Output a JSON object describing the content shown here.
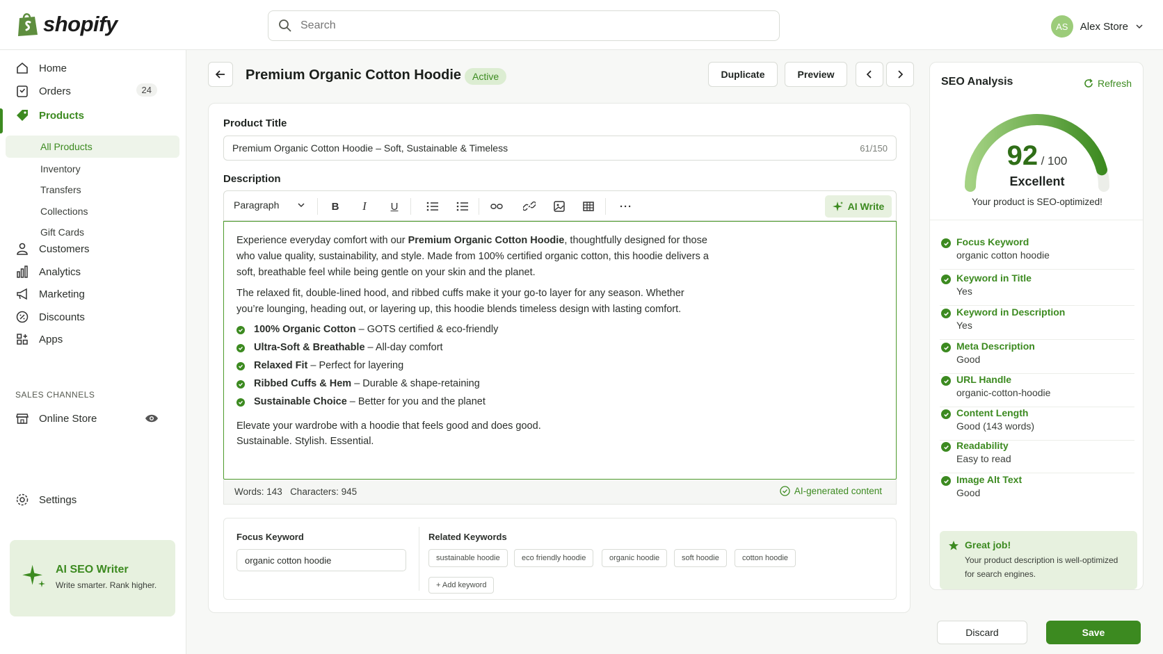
{
  "brand": {
    "name": "shopify",
    "accent": "#3c8a20"
  },
  "search": {
    "placeholder": "Search"
  },
  "user": {
    "initials": "AS",
    "name": "Alex Store"
  },
  "sidebar": {
    "items": [
      {
        "label": "Home",
        "icon": "home-icon"
      },
      {
        "label": "Orders",
        "icon": "orders-icon",
        "badge": "24"
      },
      {
        "label": "Products",
        "icon": "tag-icon"
      },
      {
        "label": "Customers",
        "icon": "person-icon"
      },
      {
        "label": "Analytics",
        "icon": "bar-chart-icon"
      },
      {
        "label": "Marketing",
        "icon": "megaphone-icon"
      },
      {
        "label": "Discounts",
        "icon": "discount-icon"
      },
      {
        "label": "Apps",
        "icon": "apps-icon"
      }
    ],
    "product_sub": [
      "All Products",
      "Inventory",
      "Transfers",
      "Collections",
      "Gift Cards"
    ],
    "sales_channels_heading": "SALES CHANNELS",
    "online_store": "Online Store",
    "settings": "Settings",
    "ai_card": {
      "title": "AI SEO Writer",
      "subtitle": "Write smarter. Rank higher."
    }
  },
  "product": {
    "title": "Premium Organic Cotton Hoodie",
    "status": "Active",
    "actions": {
      "duplicate": "Duplicate",
      "preview": "Preview"
    }
  },
  "form": {
    "title_label": "Product Title",
    "title_value": "Premium Organic Cotton Hoodie – Soft, Sustainable & Timeless",
    "title_count": "61/150",
    "description_label": "Description",
    "toolbar": {
      "paragraph": "Paragraph",
      "ai_write": "AI Write"
    },
    "description": {
      "intro_pre": "Experience everyday comfort with our ",
      "intro_bold": "Premium Organic Cotton Hoodie",
      "intro_post": ", thoughtfully designed for those who value quality, sustainability, and style. Made from 100% certified organic cotton, this hoodie delivers a soft, breathable feel while being gentle on your skin and the planet.",
      "para2": "The relaxed fit, double-lined hood, and ribbed cuffs make it your go-to layer for any season. Whether you’re lounging, heading out, or layering up, this hoodie blends timeless design with lasting comfort.",
      "bullets": [
        {
          "bold": "100% Organic Cotton",
          "text": " – GOTS certified & eco-friendly"
        },
        {
          "bold": "Ultra-Soft & Breathable",
          "text": " – All-day comfort"
        },
        {
          "bold": "Relaxed Fit",
          "text": " – Perfect for layering"
        },
        {
          "bold": "Ribbed Cuffs & Hem",
          "text": " – Durable & shape-retaining"
        },
        {
          "bold": "Sustainable Choice",
          "text": " – Better for you and the planet"
        }
      ],
      "closing1": "Elevate your wardrobe with a hoodie that feels good and does good.",
      "closing2": "Sustainable. Stylish. Essential."
    },
    "stats": {
      "words": "Words: 143",
      "characters": "Characters: 945",
      "ai_badge": "AI-generated content"
    },
    "focus_keyword_label": "Focus Keyword",
    "focus_keyword_value": "organic cotton hoodie",
    "related_label": "Related Keywords",
    "related": [
      "sustainable hoodie",
      "eco friendly hoodie",
      "organic hoodie",
      "soft hoodie",
      "cotton hoodie"
    ],
    "add_keyword": "+ Add keyword"
  },
  "seo": {
    "title": "SEO Analysis",
    "refresh": "Refresh",
    "score": "92",
    "score_max": "/ 100",
    "score_fraction": 0.92,
    "rating": "Excellent",
    "summary": "Your product is SEO-optimized!",
    "checks": [
      {
        "key": "Focus Keyword",
        "value": "organic cotton hoodie"
      },
      {
        "key": "Keyword in Title",
        "value": "Yes"
      },
      {
        "key": "Keyword in Description",
        "value": "Yes"
      },
      {
        "key": "Meta Description",
        "value": "Good"
      },
      {
        "key": "URL Handle",
        "value": "organic-cotton-hoodie"
      },
      {
        "key": "Content Length",
        "value": "Good (143 words)"
      },
      {
        "key": "Readability",
        "value": "Easy to read"
      },
      {
        "key": "Image Alt Text",
        "value": "Good"
      }
    ],
    "great": {
      "title": "Great job!",
      "text": "Your product description is well-optimized for search engines."
    }
  },
  "footer": {
    "discard": "Discard",
    "save": "Save"
  }
}
